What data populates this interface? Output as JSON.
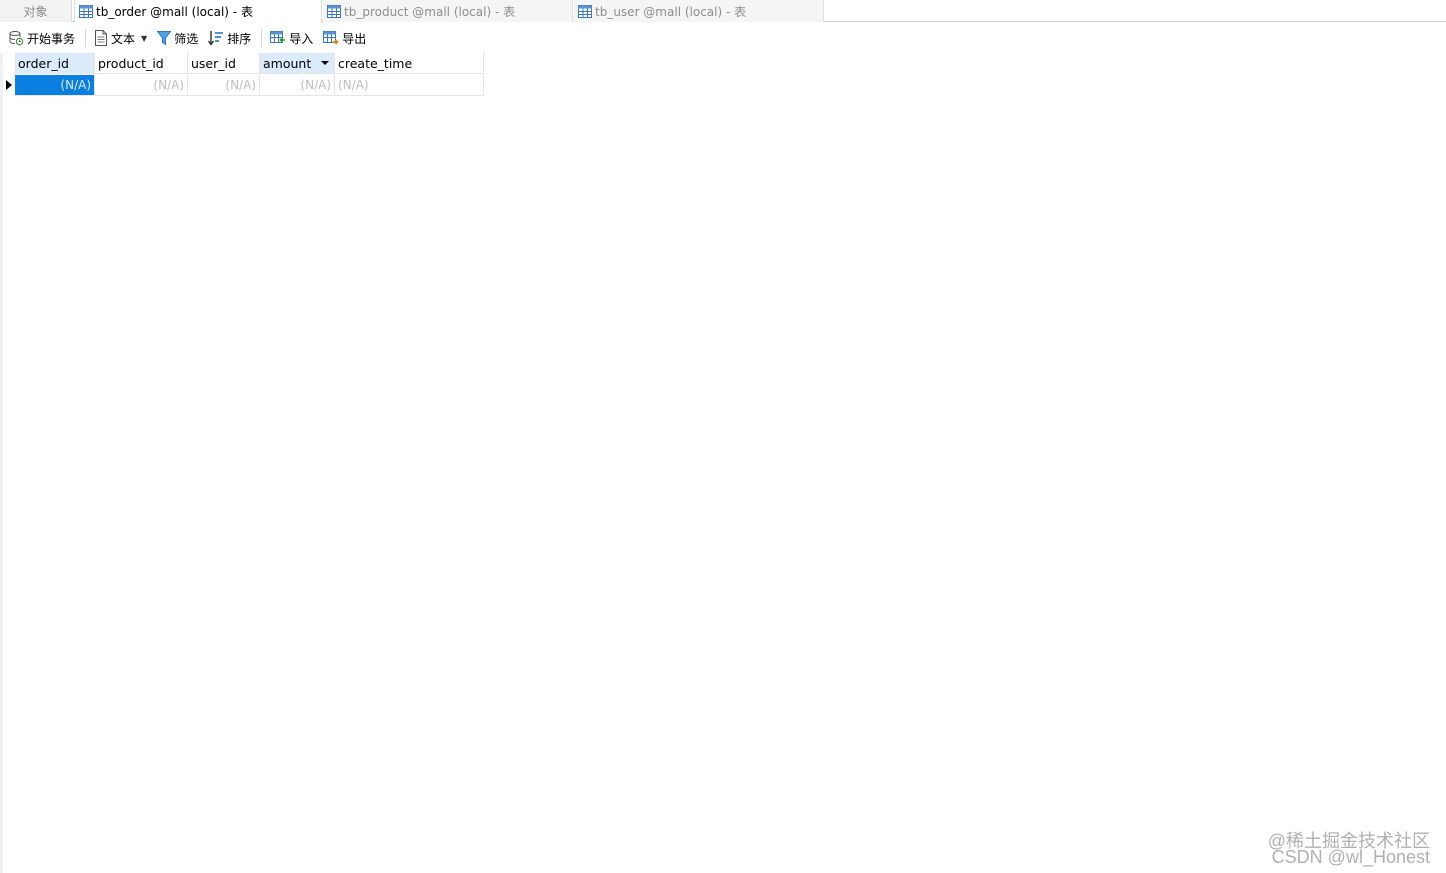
{
  "tabs": {
    "objects": "对象",
    "items": [
      {
        "label": "tb_order @mall (local) - 表"
      },
      {
        "label": "tb_product @mall (local) - 表"
      },
      {
        "label": "tb_user @mall (local) - 表"
      }
    ]
  },
  "toolbar": {
    "begin_transaction": "开始事务",
    "text": "文本",
    "filter": "筛选",
    "sort": "排序",
    "import": "导入",
    "export": "导出"
  },
  "grid": {
    "columns": [
      "order_id",
      "product_id",
      "user_id",
      "amount",
      "create_time"
    ],
    "rows": [
      [
        "(N/A)",
        "(N/A)",
        "(N/A)",
        "(N/A)",
        "(N/A)"
      ]
    ]
  },
  "watermark": {
    "line1": "@稀土掘金技术社区",
    "line2": "CSDN @wl_Honest"
  },
  "colors": {
    "selection": "#0a7fe0",
    "header_highlight": "#dcebfb",
    "null_text": "#bdbdbd"
  }
}
